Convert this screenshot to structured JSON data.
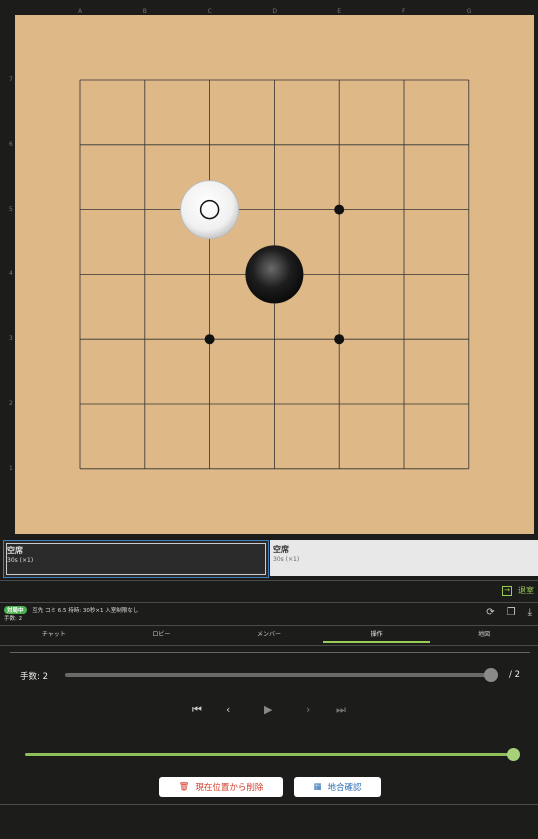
{
  "board": {
    "col_labels": [
      "A",
      "B",
      "C",
      "D",
      "E",
      "F",
      "G"
    ],
    "row_labels": [
      "7",
      "6",
      "5",
      "4",
      "3",
      "2",
      "1"
    ],
    "stones": [
      {
        "color": "white",
        "point": "C5",
        "last_move": true
      },
      {
        "color": "black",
        "point": "D4",
        "last_move": false
      }
    ],
    "star_points": [
      "E5",
      "C3",
      "E3"
    ]
  },
  "players": {
    "black": {
      "name": "空席",
      "time": "30s (×1)"
    },
    "white": {
      "name": "空席",
      "time": "30s (×1)"
    }
  },
  "exit_label": "退室",
  "game_info": {
    "status_badge": "対局中",
    "text": "互先 コミ 6.5 持時: 30秒×1 入室制限なし",
    "move_count": "手数: 2"
  },
  "tabs": [
    "チャット",
    "ロビー",
    "メンバー",
    "操作",
    "地図"
  ],
  "active_tab": "操作",
  "controls": {
    "moves_label": "手数: 2",
    "total_label": "/ 2",
    "move_fraction": 1.0,
    "delete_button": "現在位置から削除",
    "score_button": "地合確認"
  },
  "colors": {
    "accent": "#9acd55",
    "board": "#deb887",
    "danger": "#d33b2c",
    "primary": "#2b6cb0"
  }
}
